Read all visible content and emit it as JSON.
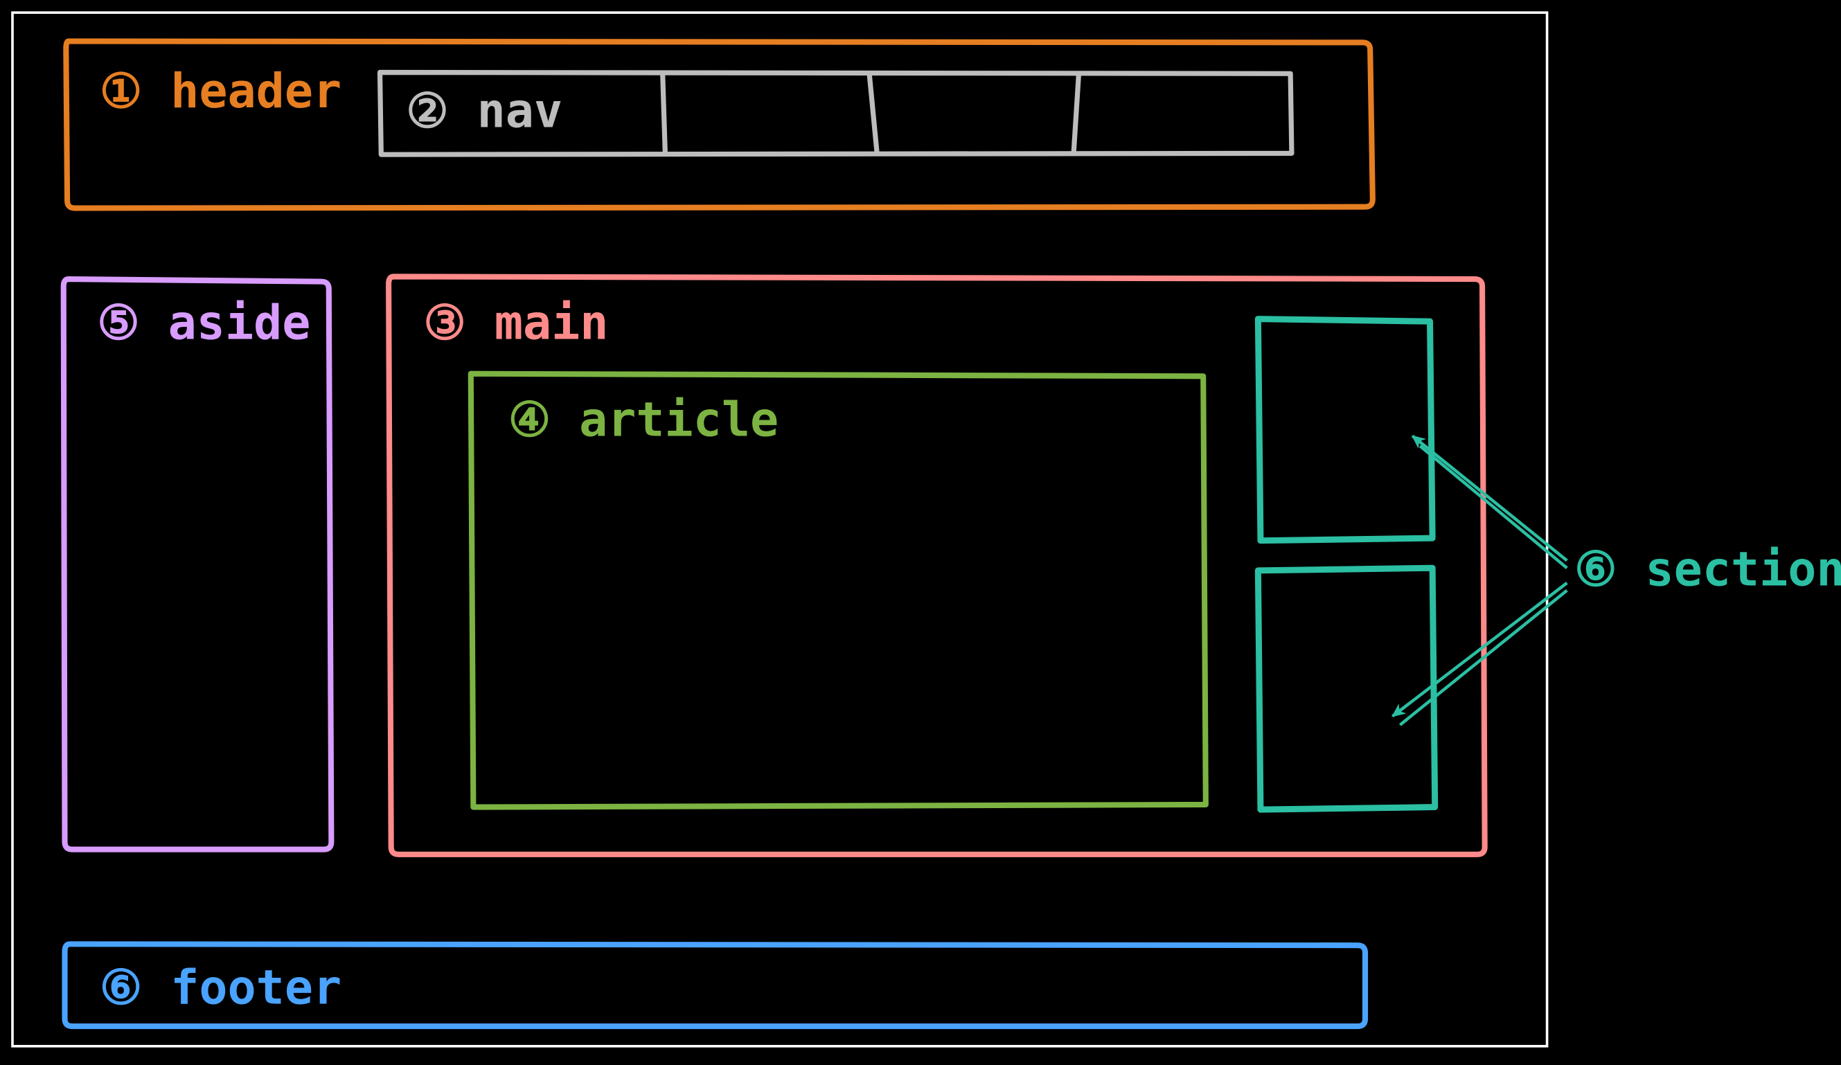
{
  "regions": {
    "header": {
      "num": "①",
      "name": "header"
    },
    "nav": {
      "num": "②",
      "name": "nav"
    },
    "main": {
      "num": "③",
      "name": "main"
    },
    "article": {
      "num": "④",
      "name": "article"
    },
    "aside": {
      "num": "⑤",
      "name": "aside"
    },
    "footer": {
      "num": "⑥",
      "name": "footer"
    },
    "section": {
      "num": "⑥",
      "name": "section"
    }
  },
  "colors": {
    "page_border": "#ffffff",
    "header": "#e67e22",
    "nav": "#bdbdbd",
    "main": "#ff8a8a",
    "article": "#7cb342",
    "aside": "#d89cff",
    "footer": "#4aa3ff",
    "section": "#2bbfa3",
    "bg": "#000000"
  }
}
